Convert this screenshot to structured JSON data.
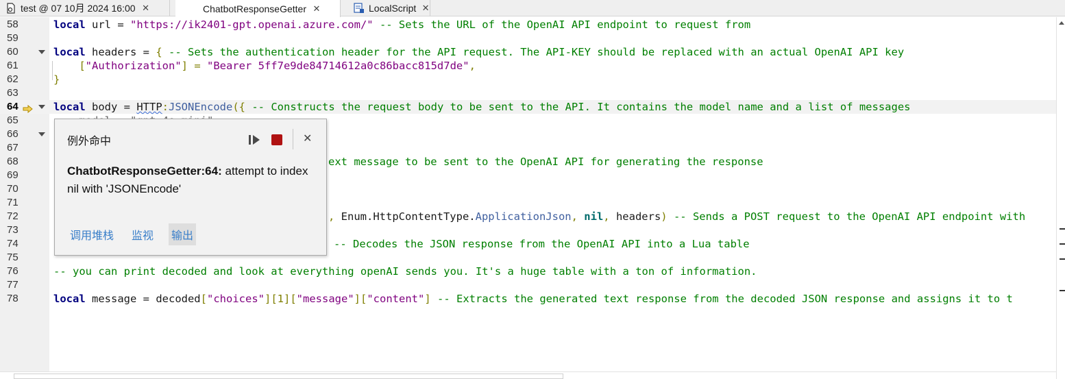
{
  "tabs": [
    {
      "label": "test @ 07 10月 2024 16:00",
      "icon": "place-file-icon"
    },
    {
      "label": "ChatbotResponseGetter",
      "icon": "none"
    },
    {
      "label": "LocalScript",
      "icon": "localscript-icon"
    }
  ],
  "lines": [
    {
      "num": "58"
    },
    {
      "num": "59"
    },
    {
      "num": "60"
    },
    {
      "num": "61"
    },
    {
      "num": "62"
    },
    {
      "num": "63"
    },
    {
      "num": "64"
    },
    {
      "num": "65"
    },
    {
      "num": "66"
    },
    {
      "num": "67"
    },
    {
      "num": "68"
    },
    {
      "num": "69"
    },
    {
      "num": "70"
    },
    {
      "num": "71"
    },
    {
      "num": "72"
    },
    {
      "num": "73"
    },
    {
      "num": "74"
    },
    {
      "num": "75"
    },
    {
      "num": "76"
    },
    {
      "num": "77"
    },
    {
      "num": "78"
    }
  ],
  "code": {
    "l58_kw": "local",
    "l58_a": " url = ",
    "l58_str": "\"https://ik2401-gpt.openai.azure.com/\"",
    "l58_cmt": " -- Sets the URL of the OpenAI API endpoint to request from",
    "l60_kw": "local",
    "l60_a": " headers = ",
    "l60_op": "{",
    "l60_cmt": " -- Sets the authentication header for the API request. The API-KEY should be replaced with an actual OpenAI API key",
    "l61_a": "    ",
    "l61_op1": "[",
    "l61_str1": "\"Authorization\"",
    "l61_op2": "] = ",
    "l61_str2": "\"Bearer 5ff7e9de84714612a0c86bacc815d7de\"",
    "l61_op3": ",",
    "l62_op": "}",
    "l64_kw": "local",
    "l64_a": " body = ",
    "l64_http": "HTTP",
    "l64_op1": ":",
    "l64_fn": "JSONEncode",
    "l64_op2": "({",
    "l64_cmt": " -- Constructs the request body to be sent to the API. It contains the model name and a list of messages",
    "l65_partial": "    model = \"gpt-4o-mini\",",
    "l68_cmt": "ext message to be sent to the OpenAI API for generating the response",
    "l72_op1": ", ",
    "l72_enum": "Enum.HttpContentType.",
    "l72_fn": "ApplicationJson",
    "l72_op2": ", ",
    "l72_nil": "nil",
    "l72_op3": ", ",
    "l72_hdr": "headers",
    "l72_op4": ")",
    "l72_cmt": " -- Sends a POST request to the OpenAI API endpoint with",
    "l74_cmt": "-- Decodes the JSON response from the OpenAI API into a Lua table",
    "l76_cmt": "-- you can print decoded and look at everything openAI sends you. It's a huge table with a ton of information.",
    "l78_kw": "local",
    "l78_a": " message = decoded",
    "l78_op1": "[",
    "l78_str1": "\"choices\"",
    "l78_op2": "][1][",
    "l78_str2": "\"message\"",
    "l78_op3": "][",
    "l78_str3": "\"content\"",
    "l78_op4": "]",
    "l78_cmt": " -- Extracts the generated text response from the decoded JSON response and assigns it to t"
  },
  "popup": {
    "title": "例外命中",
    "error_source": "ChatbotResponseGetter:64:",
    "error_message": " attempt to index nil with 'JSONEncode'",
    "links": [
      "调用堆栈",
      "监视",
      "输出"
    ],
    "selected_link": "输出"
  },
  "colors": {
    "keyword": "#00007f",
    "string": "#7f007f",
    "comment": "#007f00",
    "stop_button": "#b01212",
    "link": "#3a7fc9",
    "current_line_arrow": "#e6b800"
  }
}
